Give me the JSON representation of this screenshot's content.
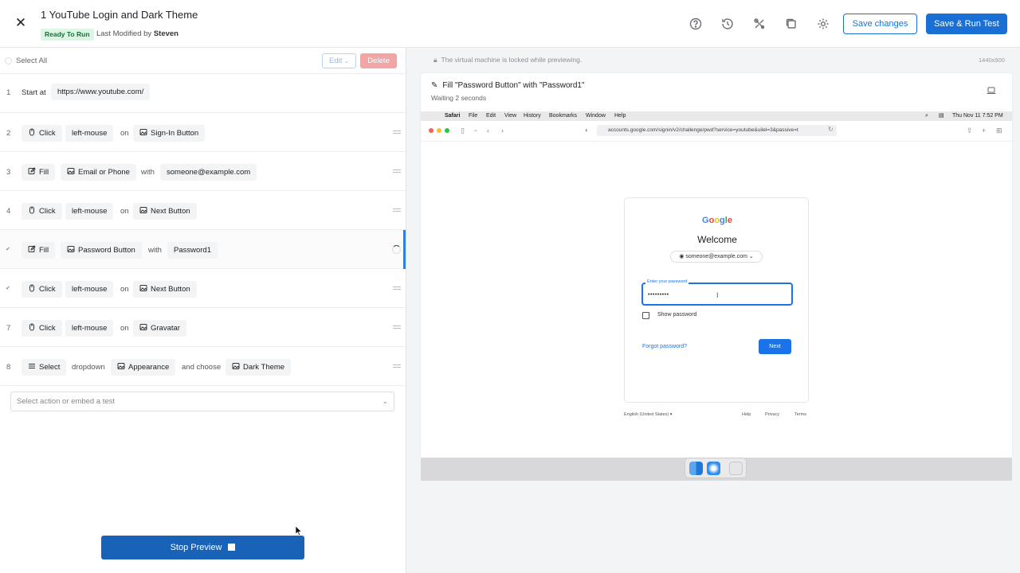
{
  "header": {
    "title": "1 YouTube Login and Dark Theme",
    "badge": "Ready To Run",
    "modified_prefix": "Last Modified by",
    "modified_by": "Steven",
    "save_label": "Save changes",
    "save_run_label": "Save & Run Test",
    "icons": [
      "help-icon",
      "history-icon",
      "tools-icon",
      "copy-icon",
      "gear-icon"
    ]
  },
  "toolbar": {
    "select_all": "Select All",
    "edit": "Edit",
    "delete": "Delete"
  },
  "steps": {
    "s1": {
      "num": "1",
      "verb": "Start at",
      "url": "https://www.youtube.com/"
    },
    "s2": {
      "num": "2",
      "action": "Click",
      "arg": "left-mouse",
      "conn": "on",
      "target": "Sign-In Button"
    },
    "s3": {
      "num": "3",
      "action": "Fill",
      "target": "Email or Phone",
      "conn": "with",
      "value": "someone@example.com"
    },
    "s4": {
      "num": "4",
      "action": "Click",
      "arg": "left-mouse",
      "conn": "on",
      "target": "Next Button"
    },
    "s5": {
      "action": "Fill",
      "target": "Password Button",
      "conn": "with",
      "value": "Password1"
    },
    "s6": {
      "action": "Click",
      "arg": "left-mouse",
      "conn": "on",
      "target": "Next Button"
    },
    "s7": {
      "num": "7",
      "action": "Click",
      "arg": "left-mouse",
      "conn": "on",
      "target": "Gravatar"
    },
    "s8": {
      "num": "8",
      "action": "Select",
      "arg": "dropdown",
      "target": "Appearance",
      "conn": "and choose",
      "value": "Dark Theme"
    }
  },
  "add_step": {
    "placeholder": "Select action or embed a test"
  },
  "stop_preview": "Stop Preview",
  "preview": {
    "lock_message": "The virtual machine is locked while previewing.",
    "resolution": "1440x900",
    "step_title": "Fill \"Password Button\" with \"Password1\"",
    "waiting": "Waiting 2 seconds",
    "menubar": {
      "app": "Safari",
      "items": [
        "File",
        "Edit",
        "View",
        "History",
        "Bookmarks",
        "Window",
        "Help"
      ],
      "clock": "Thu Nov 11  7:52 PM"
    },
    "url": "accounts.google.com/signin/v2/challenge/pwd?service=youtube&uilel=3&passive=t",
    "google": {
      "logo": "Google",
      "welcome": "Welcome",
      "account": "someone@example.com",
      "field_label": "Enter your password",
      "field_value": "•••••••••",
      "show_password": "Show password",
      "forgot": "Forgot password?",
      "next": "Next",
      "language": "English (United States)",
      "footer_help": "Help",
      "footer_privacy": "Privacy",
      "footer_terms": "Terms"
    }
  },
  "colors": {
    "primary": "#1a6fd4",
    "stop_button": "#1862b8",
    "badge_bg": "#dcf5e4",
    "badge_text": "#16703a",
    "delete_bg": "#f1a5a5",
    "google_blue": "#1a73e8"
  }
}
